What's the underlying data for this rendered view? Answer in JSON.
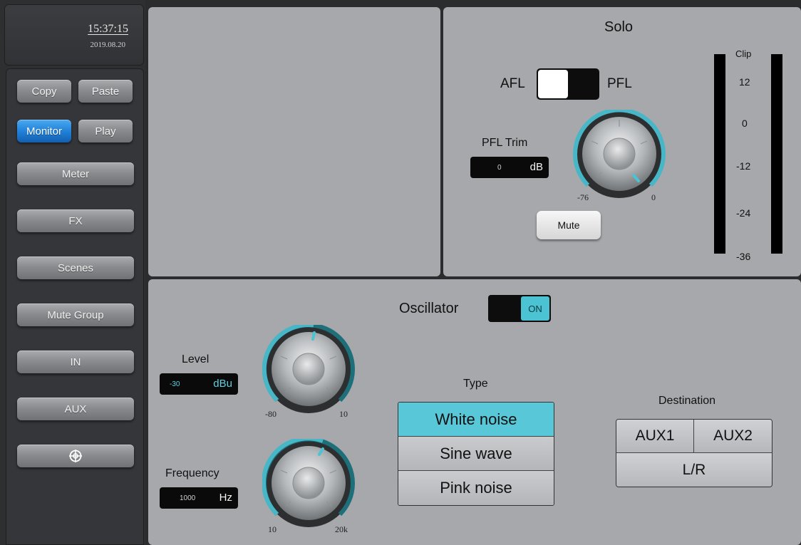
{
  "clock": {
    "time": "15:37:15",
    "date": "2019.08.20"
  },
  "sidebar": {
    "copy": "Copy",
    "paste": "Paste",
    "monitor": "Monitor",
    "play": "Play",
    "items": [
      "Meter",
      "FX",
      "Scenes",
      "Mute Group",
      "IN",
      "AUX"
    ],
    "target_icon": "crosshair-icon"
  },
  "solo": {
    "title": "Solo",
    "afl": "AFL",
    "pfl": "PFL",
    "toggle_state": "AFL",
    "pfl_trim_label": "PFL Trim",
    "pfl_trim_value": "0",
    "pfl_trim_unit": "dB",
    "knob_min": "-76",
    "knob_max": "0",
    "mute": "Mute",
    "meter": {
      "clip": "Clip",
      "ticks": [
        "12",
        "0",
        "-12",
        "-24",
        "-36"
      ]
    }
  },
  "oscillator": {
    "title": "Oscillator",
    "toggle": "ON",
    "level": {
      "label": "Level",
      "value": "-30",
      "unit": "dBu",
      "min": "-80",
      "max": "10"
    },
    "frequency": {
      "label": "Frequency",
      "value": "1000",
      "unit": "Hz",
      "min": "10",
      "max": "20k"
    },
    "type": {
      "label": "Type",
      "options": [
        "White noise",
        "Sine wave",
        "Pink noise"
      ],
      "selected": "White noise"
    },
    "destination": {
      "label": "Destination",
      "options": [
        "AUX1",
        "AUX2",
        "L/R"
      ]
    }
  },
  "colors": {
    "accent": "#4bc3d3",
    "active_blue": "#1f7ed6",
    "panel": "#a6a8ab"
  }
}
